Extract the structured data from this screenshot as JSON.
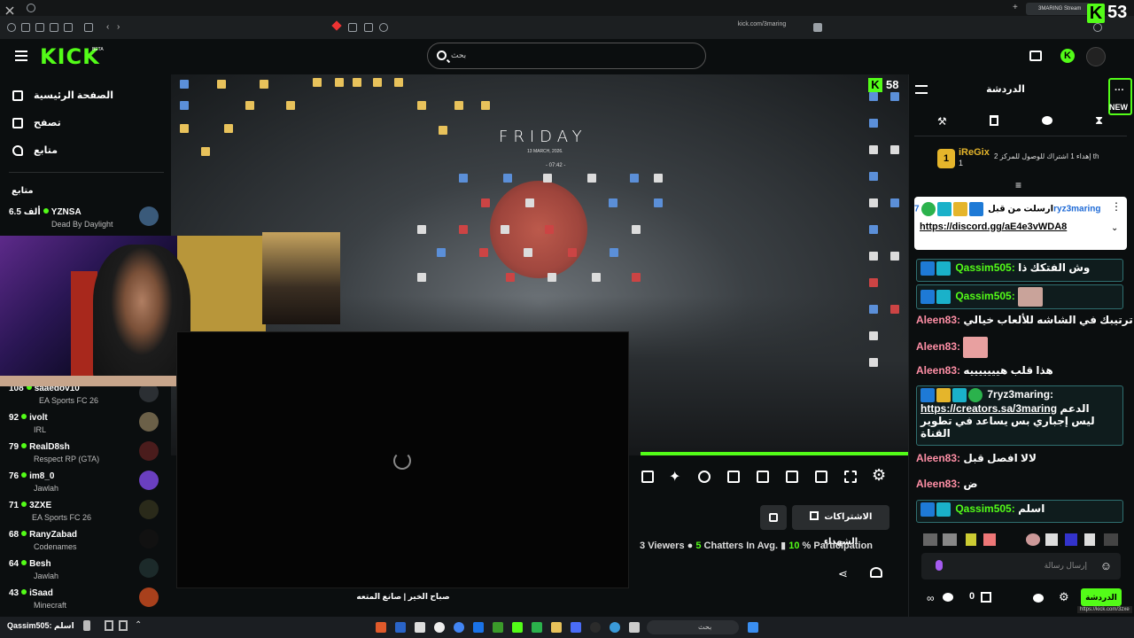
{
  "browser": {
    "tab_title": "3MARING Stream",
    "url": "kick.com/3maring",
    "kick_badge_letter": "K",
    "kick_badge_count": "53"
  },
  "header": {
    "logo": "KICK",
    "logo_tag": "BETA",
    "search_placeholder": "بحث"
  },
  "sidebar": {
    "nav": [
      {
        "label": "الصفحة الرئيسية",
        "icon": "home-icon"
      },
      {
        "label": "تصفح",
        "icon": "browse-icon"
      },
      {
        "label": "متابع",
        "icon": "heart-icon"
      }
    ],
    "following_title": "متابع",
    "channels_top": [
      {
        "viewers": "6.5 ألف",
        "name": "YZNSA",
        "game": "Dead By Daylight"
      }
    ],
    "channels": [
      {
        "viewers": "108",
        "name": "saaedov10",
        "game": "EA Sports FC 26"
      },
      {
        "viewers": "92",
        "name": "ivolt",
        "game": "IRL"
      },
      {
        "viewers": "79",
        "name": "RealD8sh",
        "game": "Respect RP (GTA)"
      },
      {
        "viewers": "76",
        "name": "im8_0",
        "game": "Jawlah"
      },
      {
        "viewers": "71",
        "name": "3ZXE",
        "game": "EA Sports FC 26"
      },
      {
        "viewers": "68",
        "name": "RanyZabad",
        "game": "Codenames"
      },
      {
        "viewers": "64",
        "name": "Besh",
        "game": "Jawlah"
      },
      {
        "viewers": "43",
        "name": "iSaad",
        "game": "Minecraft"
      }
    ]
  },
  "video": {
    "desktop_title": "FRIDAY",
    "desktop_date": "13 MARCH, 2026.",
    "desktop_time": "- 07:42 -",
    "overlay_letter": "K",
    "overlay_count": "58"
  },
  "player": {
    "caption": "صباح الخير | صانع المتعه"
  },
  "stream_info": {
    "subs_button": "الاشتراكات الشهداء",
    "viewers_value": "3",
    "viewers_label": "Viewers",
    "chatters_value": "5",
    "chatters_label": "Chatters In Avg.",
    "participation_value": "10",
    "participation_label": "% Participation"
  },
  "chat": {
    "title": "الدردشة",
    "new_label": "NEW",
    "leader": {
      "rank": "1",
      "name": "iReGix",
      "count": "1",
      "goal": "إهداء 1 اشتراك للوصول للمركز 2 th"
    },
    "pinned": {
      "pinned_by": "ارسلت من قبل",
      "user": "7ryz3maring",
      "link": "https://discord.gg/aE4e3vWDA8"
    },
    "messages": [
      {
        "user": "Qassim505:",
        "text": "وش الفتكك ذا",
        "boxed": true,
        "color": "green"
      },
      {
        "user": "Qassim505:",
        "text": "",
        "boxed": true,
        "color": "green",
        "emote": true
      },
      {
        "user": "Aleen83:",
        "text": "ترتيبك في الشاشه للألعاب خيالي",
        "boxed": false,
        "color": "pink"
      },
      {
        "user": "Aleen83:",
        "text": "",
        "boxed": false,
        "color": "pink",
        "emote": true
      },
      {
        "user": "Aleen83:",
        "text": "هذا قلب هيييييييه",
        "boxed": false,
        "color": "pink"
      }
    ],
    "mod_message": {
      "user": "7ryz3maring:",
      "link": "https://creators.sa/3maring",
      "text1": "الدعم",
      "text2": "ليس إجباري بس يساعد في تطوير القناة"
    },
    "messages_after": [
      {
        "user": "Aleen83:",
        "text": "لالا افصل قبل",
        "color": "pink"
      },
      {
        "user": "Aleen83:",
        "text": "ض",
        "color": "pink"
      },
      {
        "user": "Qassim505:",
        "text": "اسلم",
        "color": "green",
        "boxed": true
      }
    ],
    "input_placeholder": "إرسال رسالة",
    "points": "0",
    "send_label": "الدردشة",
    "status_url": "https://kick.com/3zxe"
  },
  "taskbar": {
    "search_placeholder": "بحث",
    "left_label": "Qassim505: اسلم"
  }
}
